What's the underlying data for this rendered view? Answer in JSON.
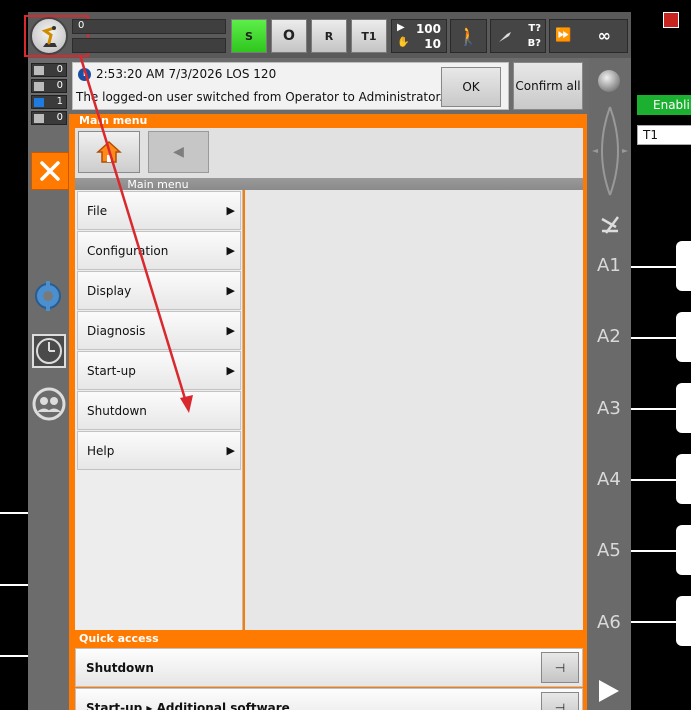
{
  "status_bar": {
    "message_count": "0",
    "mode_s": "S",
    "mode_o": "O",
    "mode_r": "R",
    "mode_t1": "T1",
    "override_top": "100",
    "override_bottom": "10",
    "tool_t": "T?",
    "tool_b": "B?",
    "infinity": "∞"
  },
  "message_counters": [
    "0",
    "0",
    "1",
    "0"
  ],
  "message": {
    "timestamp": "2:53:20 AM 7/3/2026 LOS 120",
    "text": "The logged-on user switched from Operator to Administrator.",
    "ok_label": "OK",
    "confirm_all_label": "Confirm all"
  },
  "main_menu": {
    "title": "Main menu",
    "subtitle": "Main menu",
    "items": [
      {
        "label": "File",
        "arrow": "▶"
      },
      {
        "label": "Configuration",
        "arrow": "▶"
      },
      {
        "label": "Display",
        "arrow": "▶"
      },
      {
        "label": "Diagnosis",
        "arrow": "▶"
      },
      {
        "label": "Start-up",
        "arrow": "▶"
      },
      {
        "label": "Shutdown",
        "arrow": ""
      },
      {
        "label": "Help",
        "arrow": "▶"
      }
    ]
  },
  "quick_access": {
    "title": "Quick access",
    "items": [
      {
        "label": "Shutdown"
      },
      {
        "label": "Start-up ▸ Additional software"
      }
    ]
  },
  "axes": [
    "A1",
    "A2",
    "A3",
    "A4",
    "A5",
    "A6"
  ],
  "right_panel": {
    "enable_label": "Enabling",
    "mode_value": "T1"
  },
  "colors": {
    "accent": "#ff7a00",
    "green_status": "#2fc61e",
    "highlight": "#d9282e",
    "arrow": "#d9282e"
  }
}
